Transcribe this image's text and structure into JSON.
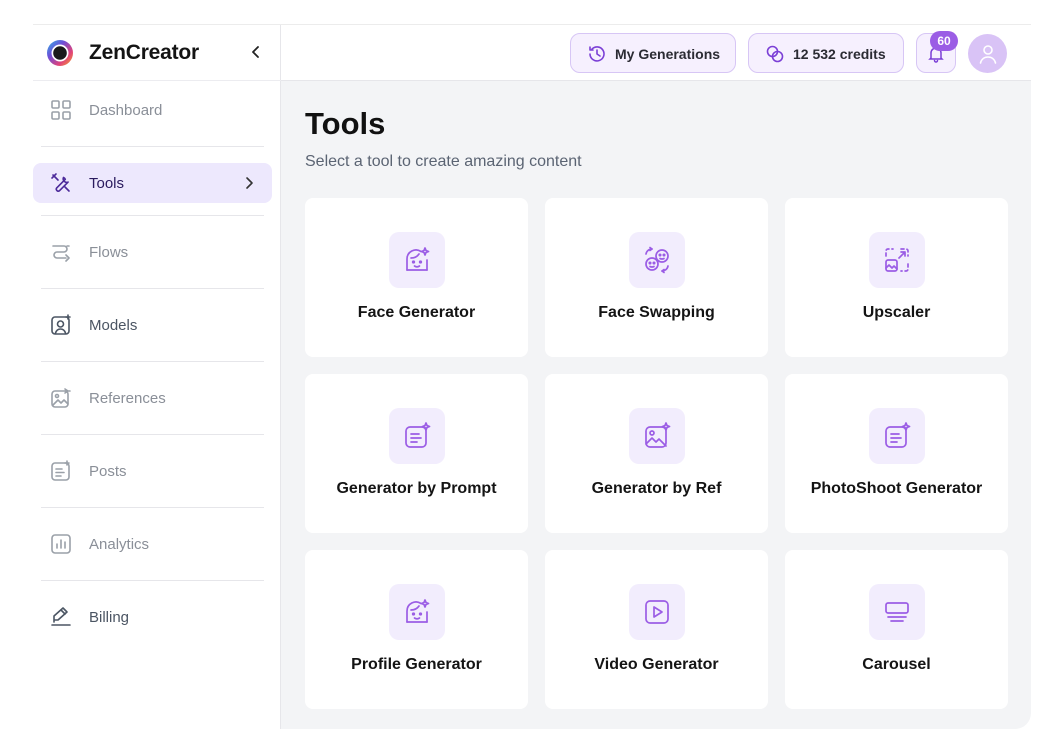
{
  "brand": {
    "name": "ZenCreator",
    "colors": {
      "accent": "#9b5de5",
      "accent_soft": "#ede8fd"
    }
  },
  "sidebar": {
    "items": [
      {
        "label": "Dashboard",
        "icon": "dashboard-icon"
      },
      {
        "label": "Tools",
        "icon": "tools-icon"
      },
      {
        "label": "Flows",
        "icon": "flows-icon"
      },
      {
        "label": "Models",
        "icon": "models-icon"
      },
      {
        "label": "References",
        "icon": "references-icon"
      },
      {
        "label": "Posts",
        "icon": "posts-icon"
      },
      {
        "label": "Analytics",
        "icon": "analytics-icon"
      },
      {
        "label": "Billing",
        "icon": "billing-icon"
      }
    ],
    "active": "Tools"
  },
  "topbar": {
    "generations_label": "My Generations",
    "credits_label": "12 532 credits",
    "notifications_count": "60"
  },
  "main": {
    "title": "Tools",
    "subtitle": "Select a tool to create amazing content",
    "tools": [
      {
        "label": "Face Generator",
        "icon": "face-generator-icon"
      },
      {
        "label": "Face Swapping",
        "icon": "face-swap-icon"
      },
      {
        "label": "Upscaler",
        "icon": "upscale-icon"
      },
      {
        "label": "Generator by Prompt",
        "icon": "prompt-icon"
      },
      {
        "label": "Generator by Ref",
        "icon": "image-ref-icon"
      },
      {
        "label": "PhotoShoot Generator",
        "icon": "prompt-icon"
      },
      {
        "label": "Profile Generator",
        "icon": "face-generator-icon"
      },
      {
        "label": "Video Generator",
        "icon": "video-icon"
      },
      {
        "label": "Carousel",
        "icon": "carousel-icon"
      }
    ]
  }
}
